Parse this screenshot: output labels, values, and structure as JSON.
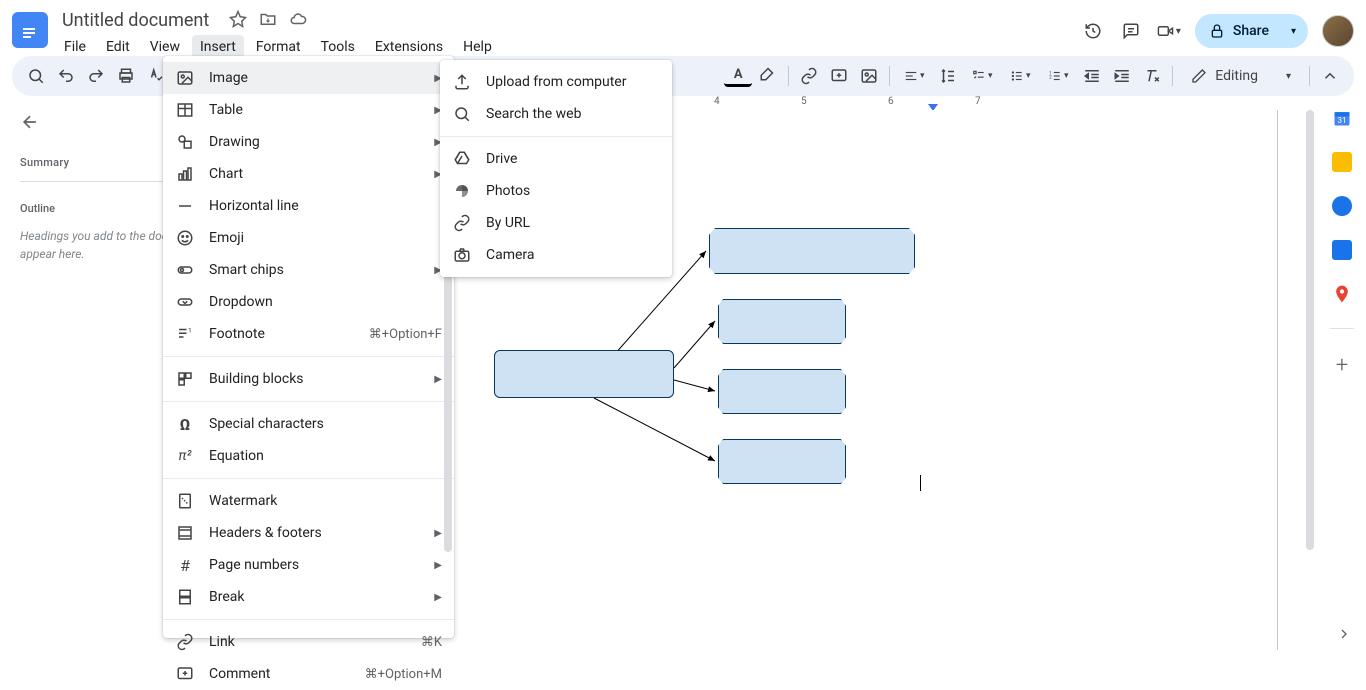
{
  "doc": {
    "title": "Untitled document"
  },
  "menubar": {
    "file": "File",
    "edit": "Edit",
    "view": "View",
    "insert": "Insert",
    "format": "Format",
    "tools": "Tools",
    "extensions": "Extensions",
    "help": "Help"
  },
  "header": {
    "share": "Share"
  },
  "toolbar": {
    "editing": "Editing"
  },
  "outline": {
    "summary": "Summary",
    "outline": "Outline",
    "hint": "Headings you add to the document will appear here."
  },
  "ruler": {
    "n4": "4",
    "n5": "5",
    "n6": "6",
    "n7": "7"
  },
  "insertMenu": {
    "image": "Image",
    "table": "Table",
    "drawing": "Drawing",
    "chart": "Chart",
    "hline": "Horizontal line",
    "emoji": "Emoji",
    "smartchips": "Smart chips",
    "dropdown": "Dropdown",
    "footnote": "Footnote",
    "footnote_sc": "⌘+Option+F",
    "building": "Building blocks",
    "special": "Special characters",
    "equation": "Equation",
    "watermark": "Watermark",
    "headers": "Headers & footers",
    "pagenum": "Page numbers",
    "break": "Break",
    "link": "Link",
    "link_sc": "⌘K",
    "comment": "Comment",
    "comment_sc": "⌘+Option+M"
  },
  "imageSubmenu": {
    "upload": "Upload from computer",
    "searchweb": "Search the web",
    "drive": "Drive",
    "photos": "Photos",
    "byurl": "By URL",
    "camera": "Camera"
  }
}
